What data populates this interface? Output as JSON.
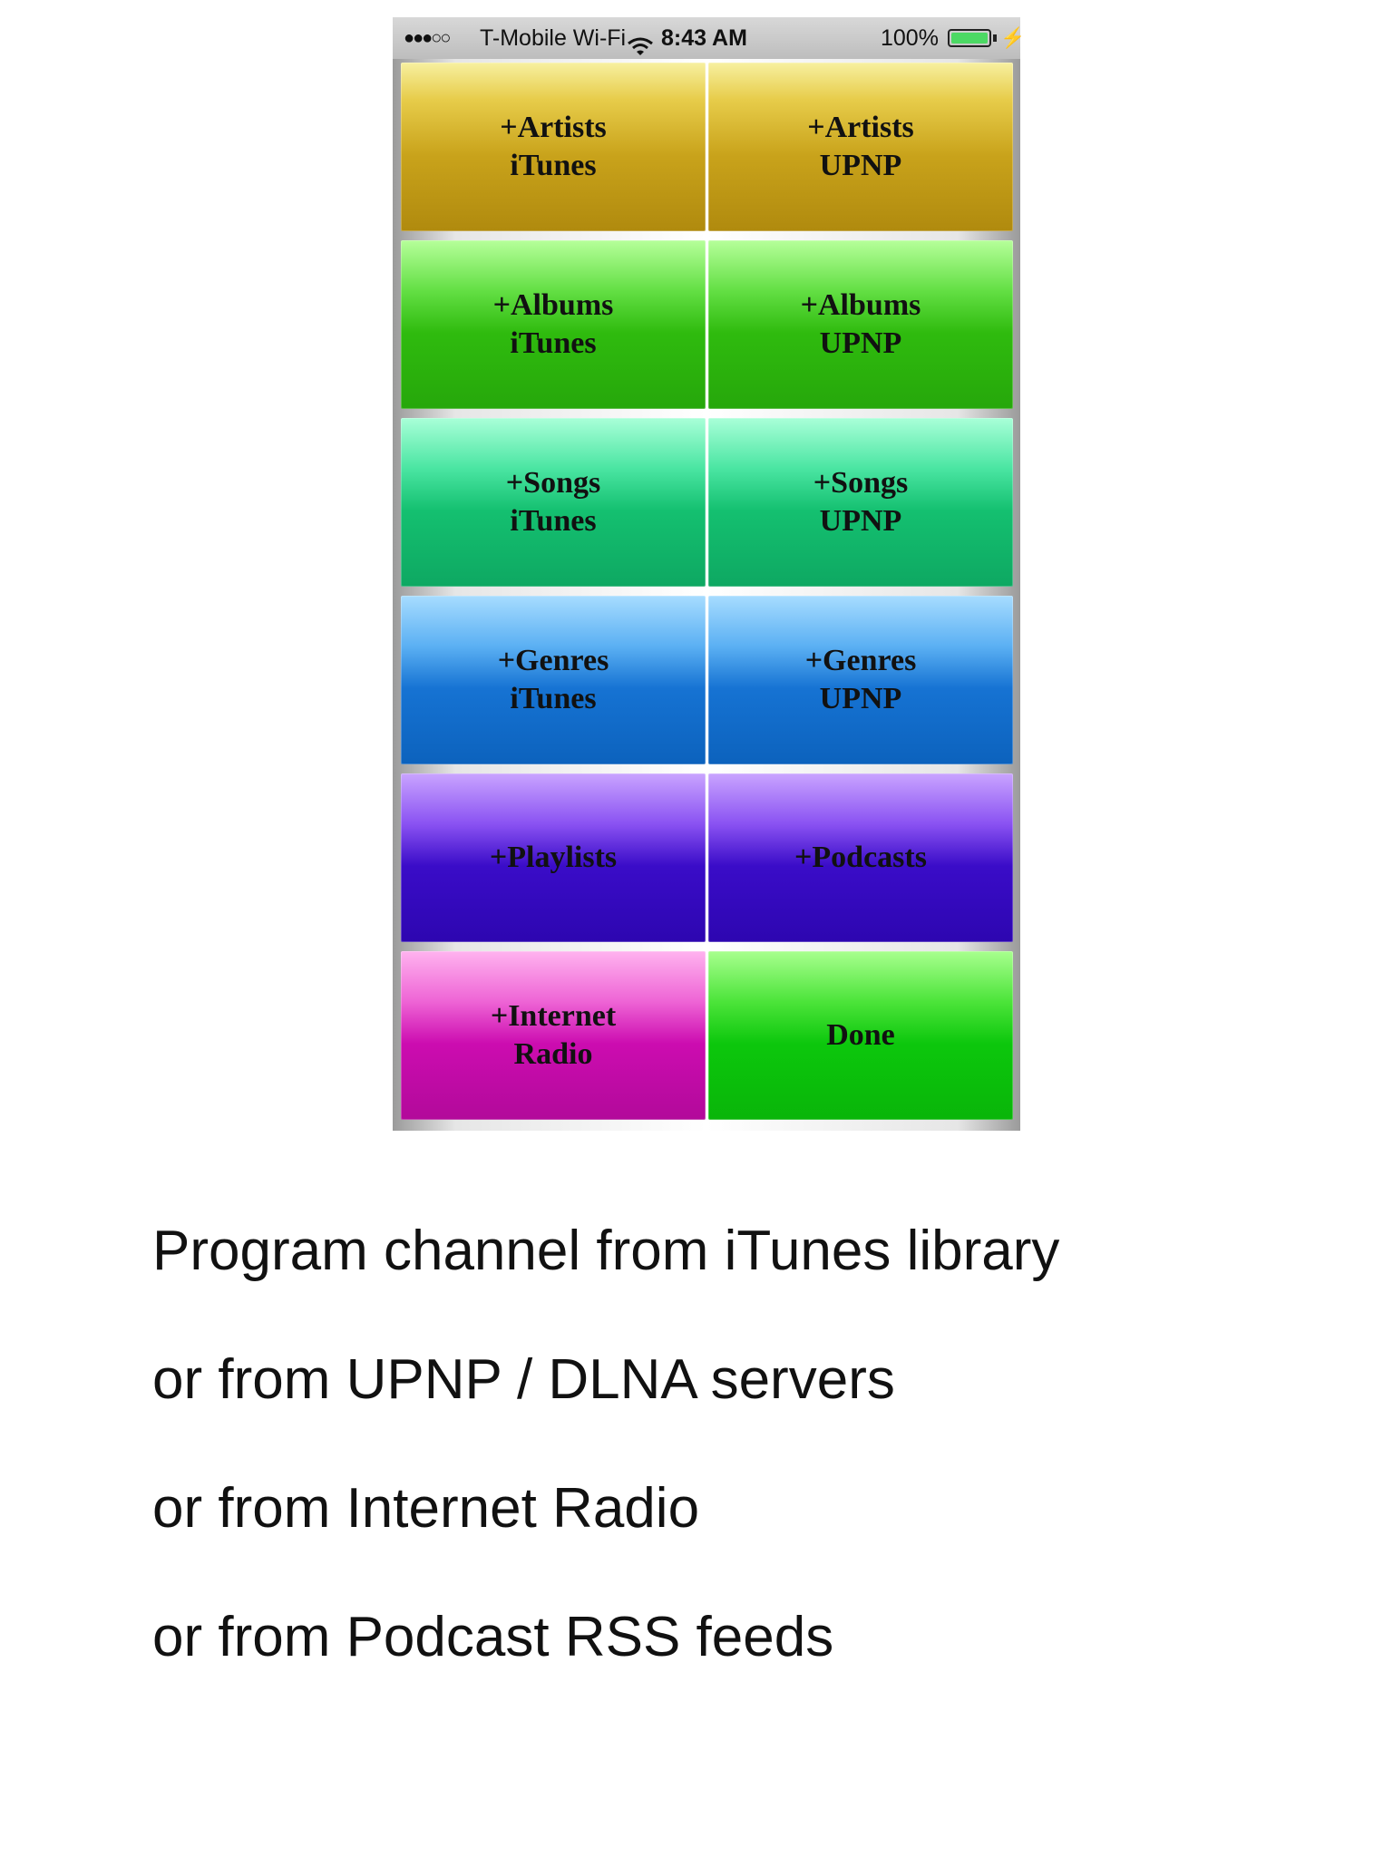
{
  "status_bar": {
    "signal": "●●●○○",
    "carrier": "T-Mobile Wi-Fi",
    "wifi_icon": "wifi-icon",
    "time": "8:43 AM",
    "battery": "100%",
    "battery_level": 1.0,
    "charge_icon": "⚡"
  },
  "tiles": {
    "artists_itunes": "+Artists\niTunes",
    "artists_upnp": "+Artists\nUPNP",
    "albums_itunes": "+Albums\niTunes",
    "albums_upnp": "+Albums\nUPNP",
    "songs_itunes": "+Songs\niTunes",
    "songs_upnp": "+Songs\nUPNP",
    "genres_itunes": "+Genres\niTunes",
    "genres_upnp": "+Genres\nUPNP",
    "playlists": "+Playlists",
    "podcasts": "+Podcasts",
    "internet_radio": "+Internet\nRadio",
    "done": "Done"
  },
  "colors": {
    "artists": "#c9a31b",
    "albums": "#2fbb0e",
    "songs": "#14c070",
    "genres": "#1673d3",
    "playlists_podcasts": "#3a0cc8",
    "internet_radio": "#cc0cb0",
    "done": "#0cc70c"
  },
  "caption": [
    "Program channel from iTunes library",
    "or from UPNP / DLNA servers",
    "or from Internet Radio",
    "or from Podcast RSS feeds"
  ]
}
